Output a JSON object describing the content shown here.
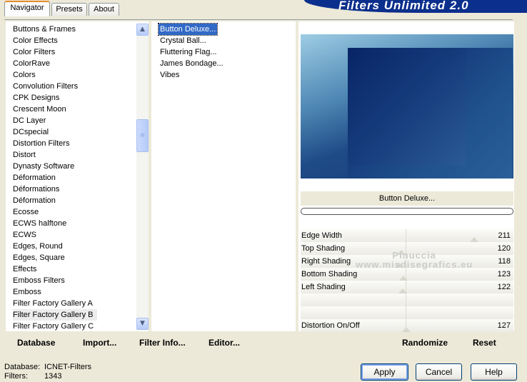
{
  "tabs": [
    {
      "label": "Navigator"
    },
    {
      "label": "Presets"
    },
    {
      "label": "About"
    }
  ],
  "banner": {
    "title": "Filters Unlimited 2.0"
  },
  "categories": [
    "Buttons & Frames",
    "Color Effects",
    "Color Filters",
    "ColorRave",
    "Colors",
    "Convolution Filters",
    "CPK Designs",
    "Crescent Moon",
    "DC Layer",
    "DCspecial",
    "Distortion Filters",
    "Distort",
    "Dynasty Software",
    "Déformation",
    "Déformations",
    "Déformation",
    "Ecosse",
    "ECWS halftone",
    "ECWS",
    "Edges, Round",
    "Edges, Square",
    "Effects",
    "Emboss Filters",
    "Emboss",
    "Filter Factory Gallery A",
    "Filter Factory Gallery B",
    "Filter Factory Gallery C"
  ],
  "selected_category": "Filter Factory Gallery B",
  "filters": [
    "Button Deluxe...",
    "Crystal Ball...",
    "Fluttering Flag...",
    "James Bondage...",
    "Vibes"
  ],
  "selected_filter": "Button Deluxe...",
  "filter_title": "Button Deluxe...",
  "sliders": [
    {
      "label": "Edge Width",
      "value": "211"
    },
    {
      "label": "Top Shading",
      "value": "120"
    },
    {
      "label": "Right Shading",
      "value": "118"
    },
    {
      "label": "Bottom Shading",
      "value": "123"
    },
    {
      "label": "Left Shading",
      "value": "122"
    },
    {
      "label": "",
      "value": ""
    },
    {
      "label": "",
      "value": ""
    },
    {
      "label": "Distortion On/Off",
      "value": "127"
    }
  ],
  "watermark": {
    "line1": "Pinuccia",
    "line2": "www.misdisegrafics.eu"
  },
  "toolbar": {
    "database": "Database",
    "import": "Import...",
    "filter_info": "Filter Info...",
    "editor": "Editor...",
    "randomize": "Randomize",
    "reset": "Reset"
  },
  "status": {
    "database_label": "Database:",
    "database_value": "ICNET-Filters",
    "filters_label": "Filters:",
    "filters_value": "1343"
  },
  "buttons": {
    "apply": "Apply",
    "cancel": "Cancel",
    "help": "Help"
  },
  "colors": {
    "banner": "#0b2f8c",
    "selection": "#3169c6",
    "accent_tab": "#e68b2c"
  }
}
